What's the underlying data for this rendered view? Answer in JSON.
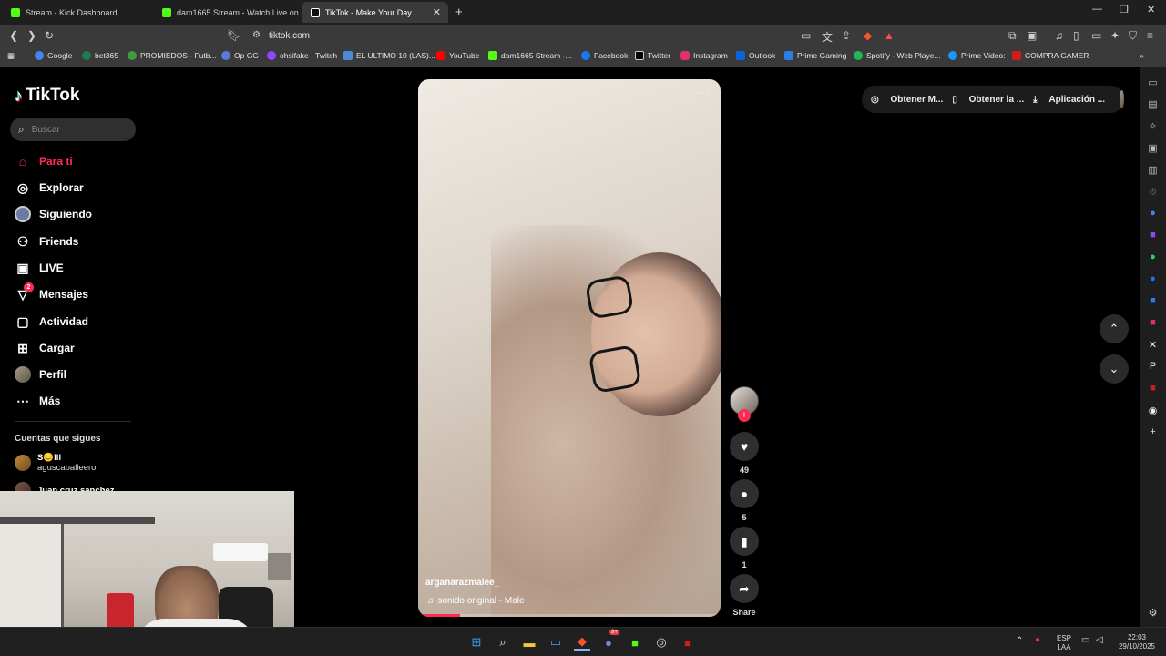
{
  "browser": {
    "tabs": [
      {
        "label": "Stream - Kick Dashboard",
        "color": "#53fc18"
      },
      {
        "label": "dam1665 Stream - Watch Live on",
        "color": "#53fc18"
      },
      {
        "label": "TikTok - Make Your Day",
        "color": "#ffffff",
        "active": true
      }
    ],
    "new_tab": "+",
    "url": "tiktok.com",
    "bookmarks": [
      {
        "label": "Google",
        "color": "#4285f4"
      },
      {
        "label": "bet365",
        "color": "#1b7d4f"
      },
      {
        "label": "PROMIEDOS - Futb...",
        "color": "#3c9d3c"
      },
      {
        "label": "Op GG",
        "color": "#5a7bd8"
      },
      {
        "label": "ohsifake - Twitch",
        "color": "#9146ff"
      },
      {
        "label": "EL ULTIMO 10 (LAS)...",
        "color": "#4a8ad4"
      },
      {
        "label": "YouTube",
        "color": "#ff0000"
      },
      {
        "label": "dam1665 Stream -...",
        "color": "#53fc18"
      },
      {
        "label": "Facebook",
        "color": "#1877f2"
      },
      {
        "label": "Twitter",
        "color": "#000000"
      },
      {
        "label": "Instagram",
        "color": "#e1306c"
      },
      {
        "label": "Outlook",
        "color": "#0a64d6"
      },
      {
        "label": "Prime Gaming",
        "color": "#2b7de9"
      },
      {
        "label": "Spotify - Web Playe...",
        "color": "#1db954"
      },
      {
        "label": "Prime Video:",
        "color": "#1a98ff"
      },
      {
        "label": "COMPRA GAMER",
        "color": "#d01c1c"
      }
    ]
  },
  "tiktok": {
    "logo": "TikTok",
    "search_placeholder": "Buscar",
    "nav": [
      {
        "label": "Para ti",
        "icon": "home-icon",
        "active": true
      },
      {
        "label": "Explorar",
        "icon": "compass-icon"
      },
      {
        "label": "Siguiendo",
        "icon": "following-avatar-icon"
      },
      {
        "label": "Friends",
        "icon": "friends-icon"
      },
      {
        "label": "LIVE",
        "icon": "live-icon"
      },
      {
        "label": "Mensajes",
        "icon": "messages-icon",
        "badge": "2"
      },
      {
        "label": "Actividad",
        "icon": "activity-icon"
      },
      {
        "label": "Cargar",
        "icon": "upload-icon"
      },
      {
        "label": "Perfil",
        "icon": "profile-avatar-icon"
      },
      {
        "label": "Más",
        "icon": "more-icon"
      }
    ],
    "following_section_title": "Cuentas que sigues",
    "following": [
      {
        "name": "S😊lll",
        "handle": "aguscaballeero"
      },
      {
        "name": "Juan cruz sanchez",
        "handle": ""
      }
    ],
    "top_buttons": [
      "Obtener M...",
      "Obtener la ...",
      "Aplicación ..."
    ],
    "video": {
      "username": "arganarazmalee_",
      "sound": "sonido original - Male",
      "progress": 0.14
    },
    "actions": {
      "likes": "49",
      "comments": "5",
      "saves": "1",
      "share_label": "Share"
    }
  },
  "taskbar": {
    "lang_top": "ESP",
    "lang_bottom": "LAA",
    "time": "22:03",
    "date": "29/10/2025",
    "discord_badge": "9+"
  }
}
